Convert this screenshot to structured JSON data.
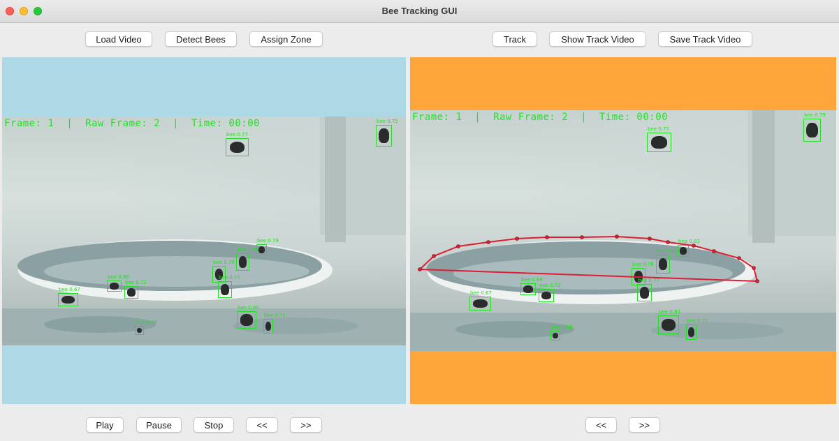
{
  "window": {
    "title": "Bee Tracking GUI"
  },
  "toolbar_left": {
    "load_video": "Load Video",
    "detect_bees": "Detect Bees",
    "assign_zone": "Assign Zone"
  },
  "toolbar_right": {
    "track": "Track",
    "show_track_video": "Show Track Video",
    "save_track_video": "Save Track Video"
  },
  "playback_left": {
    "play": "Play",
    "pause": "Pause",
    "stop": "Stop",
    "back": "<<",
    "forward": ">>"
  },
  "playback_right": {
    "back": "<<",
    "forward": ">>"
  },
  "left_view": {
    "overlay": "Frame: 1  |  Raw Frame: 2  |  Time: 00:00",
    "detections": [
      "bee 0.77",
      "bee 0.75",
      "bee 0.79",
      "bee 0.68",
      "bee 0.78",
      "bee 0.77",
      "bee 0.68",
      "bee 0.72",
      "bee 0.67",
      "bee 0.68",
      "bee 0.80",
      "bee 0.71"
    ]
  },
  "right_view": {
    "overlay": "Frame: 1  |  Raw Frame: 2  |  Time: 00:00",
    "detections": [
      "bee 0.77",
      "bee 0.79",
      "bee 0.83",
      "bee 0.68",
      "bee 0.78",
      "bee 0.77",
      "bee 0.68",
      "bee 0.72",
      "bee 0.67",
      "bee 0.68",
      "bee 0.80",
      "bee 0.71"
    ]
  },
  "colors": {
    "left_panel_bg": "#add8e6",
    "right_panel_bg": "#ffa53a",
    "detection_green": "#22e022",
    "zone_red": "#dc1e32"
  }
}
